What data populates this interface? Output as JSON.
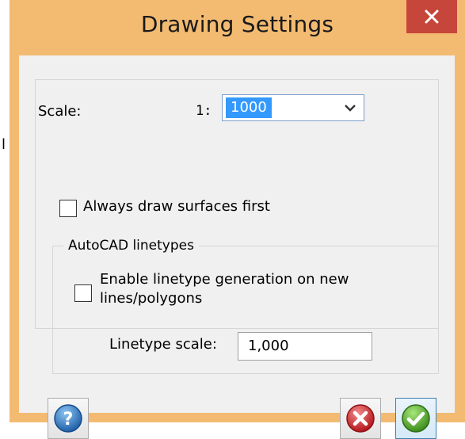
{
  "window": {
    "title": "Drawing Settings",
    "close_icon": "close-icon"
  },
  "background_fragment": "l",
  "scale": {
    "label": "Scale:",
    "prefix": "1:",
    "value": "1000"
  },
  "surfaces": {
    "label": "Always draw surfaces first",
    "checked": false
  },
  "linetypes": {
    "group_title": "AutoCAD linetypes",
    "enable_label_line1": "Enable linetype generation on new",
    "enable_label_line2": "lines/polygons",
    "enable_checked": false,
    "scale_label": "Linetype scale:",
    "scale_value": "1,000"
  },
  "buttons": {
    "help_icon": "help-icon",
    "cancel_icon": "cancel-icon",
    "ok_icon": "ok-icon"
  },
  "colors": {
    "frame": "#f3bb72",
    "close": "#c7463b",
    "selection": "#3399ff"
  }
}
